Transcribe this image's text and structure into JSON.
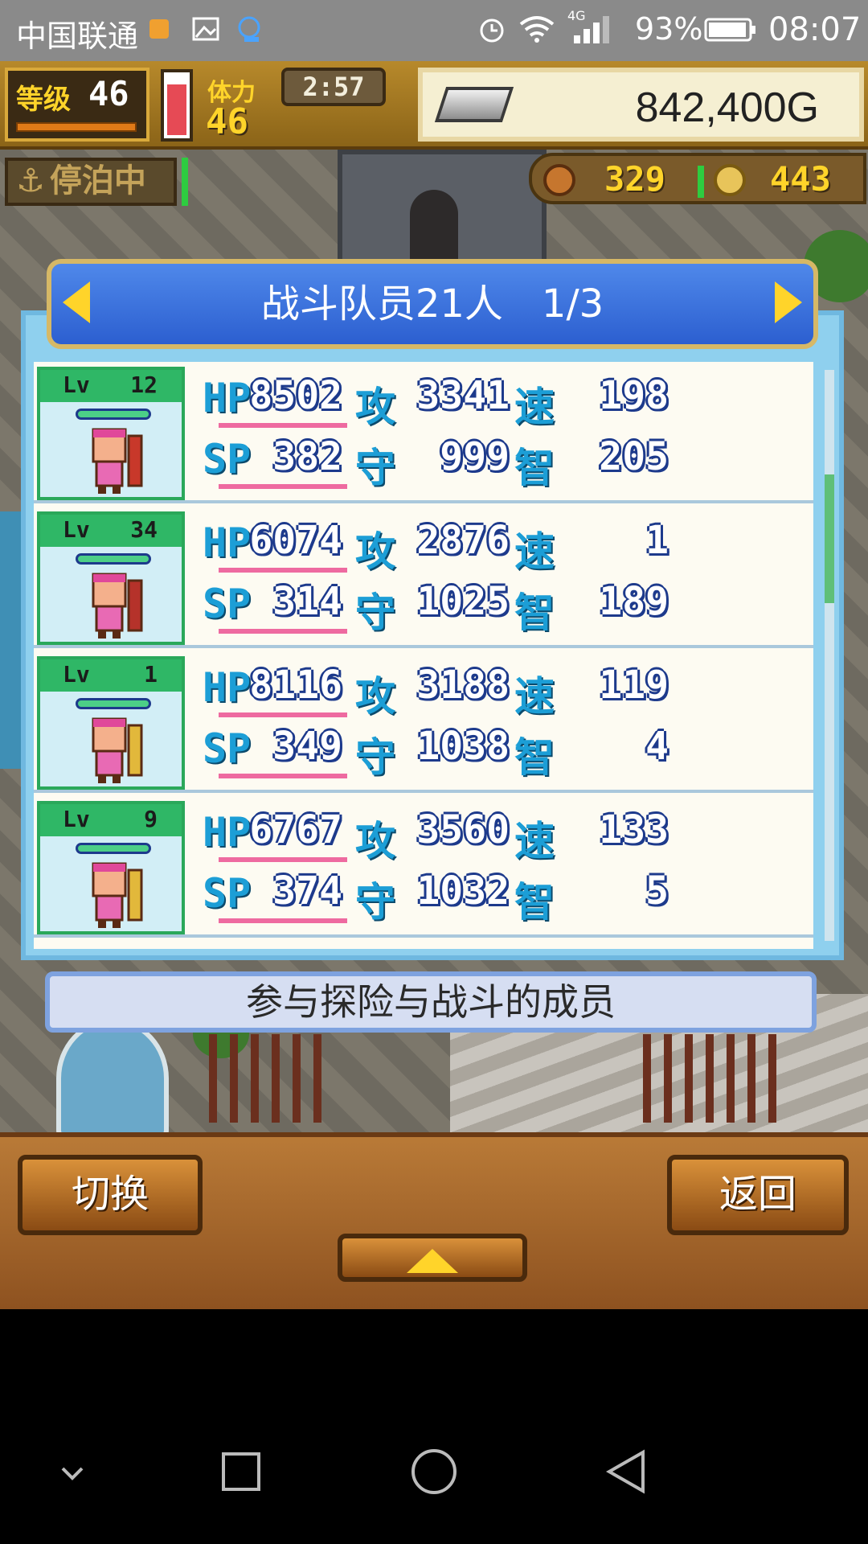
{
  "status_bar": {
    "carrier": "中国联通",
    "battery_percent": "93%",
    "time": "08:07",
    "network": "4G"
  },
  "hud": {
    "level_label": "等级",
    "level_value": "46",
    "stamina_label": "体力",
    "stamina_value": "46",
    "stamina_fill": 0.85,
    "timer": "2:57",
    "gold": "842,400G",
    "status": "停泊中",
    "food_count": "329",
    "medal_count": "443"
  },
  "panel": {
    "title": "战斗队员21人　1/3",
    "description": "参与探险与战斗的成员"
  },
  "stat_labels": {
    "hp": "HP",
    "sp": "SP",
    "attack": "攻",
    "defense": "守",
    "speed": "速",
    "intelligence": "智",
    "lv": "Lv"
  },
  "members": [
    {
      "lv": "12",
      "hp": "8502",
      "sp": "382",
      "attack": "3341",
      "defense": "999",
      "speed": "198",
      "intelligence": "205",
      "weapon_color": "#c8382a"
    },
    {
      "lv": "34",
      "hp": "6074",
      "sp": "314",
      "attack": "2876",
      "defense": "1025",
      "speed": "1",
      "intelligence": "189",
      "weapon_color": "#b5322a"
    },
    {
      "lv": "1",
      "hp": "8116",
      "sp": "349",
      "attack": "3188",
      "defense": "1038",
      "speed": "119",
      "intelligence": "4",
      "weapon_color": "#e2b83b"
    },
    {
      "lv": "9",
      "hp": "6767",
      "sp": "374",
      "attack": "3560",
      "defense": "1032",
      "speed": "133",
      "intelligence": "5",
      "weapon_color": "#e2b83b"
    }
  ],
  "buttons": {
    "switch": "切换",
    "back": "返回"
  },
  "icons": {
    "alarm": "alarm-icon",
    "wifi": "wifi-icon",
    "signal": "signal-icon",
    "battery": "battery-icon",
    "gold": "silver-bar-icon",
    "anchor": "anchor-icon"
  }
}
